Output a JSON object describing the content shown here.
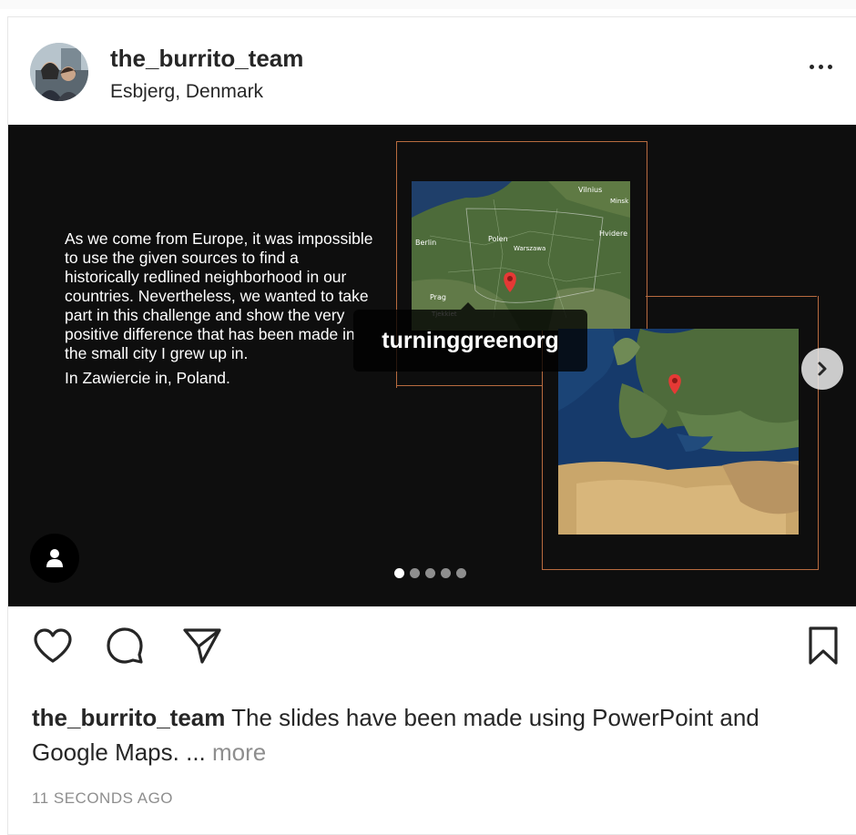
{
  "post": {
    "username": "the_burrito_team",
    "location": "Esbjerg, Denmark",
    "more_icon": "more-horizontal-icon"
  },
  "slide": {
    "paragraph1": "As we come from Europe, it was impossible to use the given sources to find a historically redlined neighborhood in our countries. Nevertheless, we wanted to take part in this challenge and show the very positive difference that has been made in the small city I grew up in.",
    "paragraph2": "In Zawiercie in, Poland.",
    "map_labels": [
      "Vilnius",
      "Minsk",
      "Hvidere",
      "Berlin",
      "Polen",
      "Warszawa",
      "Prag",
      "Tjekkiet"
    ],
    "tag_label": "turninggreenorg",
    "carousel": {
      "count": 5,
      "active": 0
    },
    "colors": {
      "frame": "#b86b3f",
      "background": "#0e0e0e"
    }
  },
  "actions": {
    "like_icon": "heart-icon",
    "comment_icon": "comment-icon",
    "share_icon": "send-icon",
    "save_icon": "bookmark-icon"
  },
  "caption": {
    "username": "the_burrito_team",
    "text": "The slides have been made using PowerPoint and Google Maps. ...",
    "more_label": "more"
  },
  "timestamp": "11 SECONDS AGO"
}
